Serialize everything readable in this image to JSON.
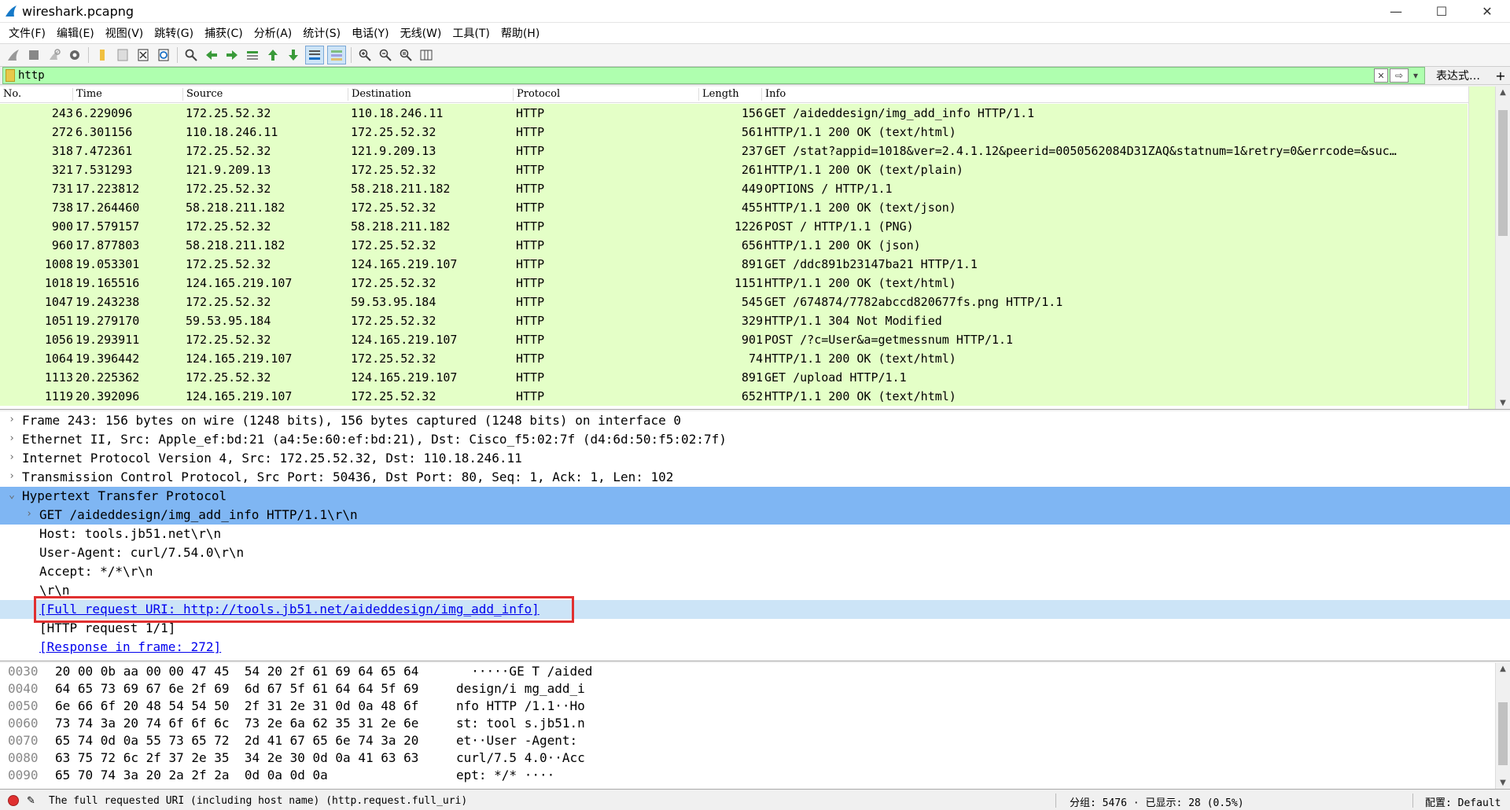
{
  "window": {
    "title": "wireshark.pcapng",
    "min": "—",
    "max": "☐",
    "close": "✕"
  },
  "menu": [
    "文件(F)",
    "编辑(E)",
    "视图(V)",
    "跳转(G)",
    "捕获(C)",
    "分析(A)",
    "统计(S)",
    "电话(Y)",
    "无线(W)",
    "工具(T)",
    "帮助(H)"
  ],
  "filter": {
    "value": "http",
    "expression_label": "表达式…",
    "plus_label": "+"
  },
  "columns": {
    "no": "No.",
    "time": "Time",
    "source": "Source",
    "destination": "Destination",
    "protocol": "Protocol",
    "length": "Length",
    "info": "Info"
  },
  "packets": [
    {
      "no": "243",
      "time": "6.229096",
      "src": "172.25.52.32",
      "dst": "110.18.246.11",
      "proto": "HTTP",
      "len": "156",
      "info": "GET /aideddesign/img_add_info HTTP/1.1"
    },
    {
      "no": "272",
      "time": "6.301156",
      "src": "110.18.246.11",
      "dst": "172.25.52.32",
      "proto": "HTTP",
      "len": "561",
      "info": "HTTP/1.1 200 OK  (text/html)"
    },
    {
      "no": "318",
      "time": "7.472361",
      "src": "172.25.52.32",
      "dst": "121.9.209.13",
      "proto": "HTTP",
      "len": "237",
      "info": "GET /stat?appid=1018&ver=2.4.1.12&peerid=0050562084D31ZAQ&statnum=1&retry=0&errcode=&suc…"
    },
    {
      "no": "321",
      "time": "7.531293",
      "src": "121.9.209.13",
      "dst": "172.25.52.32",
      "proto": "HTTP",
      "len": "261",
      "info": "HTTP/1.1 200 OK  (text/plain)"
    },
    {
      "no": "731",
      "time": "17.223812",
      "src": "172.25.52.32",
      "dst": "58.218.211.182",
      "proto": "HTTP",
      "len": "449",
      "info": "OPTIONS / HTTP/1.1"
    },
    {
      "no": "738",
      "time": "17.264460",
      "src": "58.218.211.182",
      "dst": "172.25.52.32",
      "proto": "HTTP",
      "len": "455",
      "info": "HTTP/1.1 200 OK  (text/json)"
    },
    {
      "no": "900",
      "time": "17.579157",
      "src": "172.25.52.32",
      "dst": "58.218.211.182",
      "proto": "HTTP",
      "len": "1226",
      "info": "POST / HTTP/1.1  (PNG)"
    },
    {
      "no": "960",
      "time": "17.877803",
      "src": "58.218.211.182",
      "dst": "172.25.52.32",
      "proto": "HTTP",
      "len": "656",
      "info": "HTTP/1.1 200 OK  (json)"
    },
    {
      "no": "1008",
      "time": "19.053301",
      "src": "172.25.52.32",
      "dst": "124.165.219.107",
      "proto": "HTTP",
      "len": "891",
      "info": "GET /ddc891b23147ba21 HTTP/1.1"
    },
    {
      "no": "1018",
      "time": "19.165516",
      "src": "124.165.219.107",
      "dst": "172.25.52.32",
      "proto": "HTTP",
      "len": "1151",
      "info": "HTTP/1.1 200 OK  (text/html)"
    },
    {
      "no": "1047",
      "time": "19.243238",
      "src": "172.25.52.32",
      "dst": "59.53.95.184",
      "proto": "HTTP",
      "len": "545",
      "info": "GET /674874/7782abccd820677fs.png HTTP/1.1"
    },
    {
      "no": "1051",
      "time": "19.279170",
      "src": "59.53.95.184",
      "dst": "172.25.52.32",
      "proto": "HTTP",
      "len": "329",
      "info": "HTTP/1.1 304 Not Modified"
    },
    {
      "no": "1056",
      "time": "19.293911",
      "src": "172.25.52.32",
      "dst": "124.165.219.107",
      "proto": "HTTP",
      "len": "901",
      "info": "POST /?c=User&a=getmessnum HTTP/1.1"
    },
    {
      "no": "1064",
      "time": "19.396442",
      "src": "124.165.219.107",
      "dst": "172.25.52.32",
      "proto": "HTTP",
      "len": "74",
      "info": "HTTP/1.1 200 OK  (text/html)"
    },
    {
      "no": "1113",
      "time": "20.225362",
      "src": "172.25.52.32",
      "dst": "124.165.219.107",
      "proto": "HTTP",
      "len": "891",
      "info": "GET /upload HTTP/1.1"
    },
    {
      "no": "1119",
      "time": "20.392096",
      "src": "124.165.219.107",
      "dst": "172.25.52.32",
      "proto": "HTTP",
      "len": "652",
      "info": "HTTP/1.1 200 OK  (text/html)"
    }
  ],
  "details": [
    {
      "indent": 0,
      "arrow": ">",
      "text": "Frame 243: 156 bytes on wire (1248 bits), 156 bytes captured (1248 bits) on interface 0",
      "style": ""
    },
    {
      "indent": 0,
      "arrow": ">",
      "text": "Ethernet II, Src: Apple_ef:bd:21 (a4:5e:60:ef:bd:21), Dst: Cisco_f5:02:7f (d4:6d:50:f5:02:7f)",
      "style": ""
    },
    {
      "indent": 0,
      "arrow": ">",
      "text": "Internet Protocol Version 4, Src: 172.25.52.32, Dst: 110.18.246.11",
      "style": ""
    },
    {
      "indent": 0,
      "arrow": ">",
      "text": "Transmission Control Protocol, Src Port: 50436, Dst Port: 80, Seq: 1, Ack: 1, Len: 102",
      "style": ""
    },
    {
      "indent": 0,
      "arrow": "v",
      "text": "Hypertext Transfer Protocol",
      "style": "sel"
    },
    {
      "indent": 1,
      "arrow": ">",
      "text": "GET /aideddesign/img_add_info HTTP/1.1\\r\\n",
      "style": "sel"
    },
    {
      "indent": 1,
      "arrow": "",
      "text": "Host: tools.jb51.net\\r\\n",
      "style": ""
    },
    {
      "indent": 1,
      "arrow": "",
      "text": "User-Agent: curl/7.54.0\\r\\n",
      "style": ""
    },
    {
      "indent": 1,
      "arrow": "",
      "text": "Accept: */*\\r\\n",
      "style": ""
    },
    {
      "indent": 1,
      "arrow": "",
      "text": "\\r\\n",
      "style": ""
    },
    {
      "indent": 1,
      "arrow": "",
      "text": "[Full request URI: http://tools.jb51.net/aideddesign/img_add_info]",
      "style": "hl link"
    },
    {
      "indent": 1,
      "arrow": "",
      "text": "[HTTP request 1/1]",
      "style": ""
    },
    {
      "indent": 1,
      "arrow": "",
      "text": "[Response in frame: 272]",
      "style": "link"
    }
  ],
  "bytes": [
    {
      "off": "0030",
      "hex": "20 00 0b aa 00 00 47 45  54 20 2f 61 69 64 65 64",
      "ascii": "  ·····GE T /aided"
    },
    {
      "off": "0040",
      "hex": "64 65 73 69 67 6e 2f 69  6d 67 5f 61 64 64 5f 69",
      "ascii": "design/i mg_add_i"
    },
    {
      "off": "0050",
      "hex": "6e 66 6f 20 48 54 54 50  2f 31 2e 31 0d 0a 48 6f",
      "ascii": "nfo HTTP /1.1··Ho"
    },
    {
      "off": "0060",
      "hex": "73 74 3a 20 74 6f 6f 6c  73 2e 6a 62 35 31 2e 6e",
      "ascii": "st: tool s.jb51.n"
    },
    {
      "off": "0070",
      "hex": "65 74 0d 0a 55 73 65 72  2d 41 67 65 6e 74 3a 20",
      "ascii": "et··User -Agent: "
    },
    {
      "off": "0080",
      "hex": "63 75 72 6c 2f 37 2e 35  34 2e 30 0d 0a 41 63 63",
      "ascii": "curl/7.5 4.0··Acc"
    },
    {
      "off": "0090",
      "hex": "65 70 74 3a 20 2a 2f 2a  0d 0a 0d 0a",
      "ascii": "ept: */* ····"
    }
  ],
  "status": {
    "message": "The full requested URI (including host name) (http.request.full_uri)",
    "packets": "分组: 5476 · 已显示: 28 (0.5%)",
    "profile": "配置: Default"
  }
}
